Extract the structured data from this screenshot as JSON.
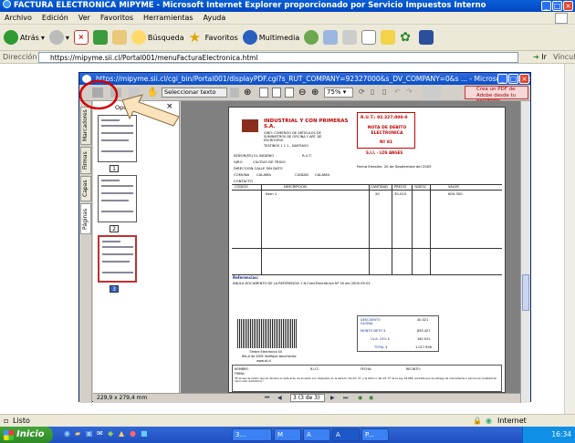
{
  "window": {
    "title": "FACTURA ELECTRONICA MIPYME - Microsoft Internet Explorer proporcionado por Servicio Impuestos Interno"
  },
  "menu": [
    "Archivo",
    "Edición",
    "Ver",
    "Favoritos",
    "Herramientas",
    "Ayuda"
  ],
  "toolbar": {
    "back": "Atrás",
    "search": "Búsqueda",
    "favorites": "Favoritos",
    "multimedia": "Multimedia"
  },
  "address": {
    "label": "Dirección",
    "url": "https://mipyme.sii.cl/Portal001/menuFacturaElectronica.html",
    "go": "Ir",
    "links": "Vínculos"
  },
  "popup": {
    "title": "https://mipyme.sii.cl/cgi_bin/Portal001/displayPDF.cgi?s_RUT_COMPANY=92327000&s_DV_COMPANY=0&s ... - Microsoft Internet Explorer p",
    "select_text": "Seleccionar texto",
    "zoom": "75%",
    "acrobat_ad": "Crea un PDF de Adobe desde tu escritorio",
    "thumbs_label": "Opciones",
    "tabs": [
      "Marcadores",
      "Firmas",
      "Capas",
      "Páginas"
    ],
    "page_nums": [
      "1",
      "2",
      "3"
    ],
    "page_size": "229,9 x 279,4 mm",
    "page_nav": "3 (3 de 3)"
  },
  "doc": {
    "company": "INDUSTRIAL Y CON PRIMERAS S.A.",
    "giro": "GIRO: COMERCIO DE ARTÍCULOS DE SUMINISTROS DE OFICINA Y ART. DE ESCRITORIO",
    "address": "TEATINOS 1 1 1 - SANTIAGO",
    "rut": "R.U.T.: 92.327.000-0",
    "doctype": "NOTA DE DEBITO ELECTRONICA",
    "folio": "Nº 81",
    "sii": "S.I.I. - LOS ANGES",
    "fields": {
      "senor": "SEÑOR(ES) EL INGENIO",
      "rut": "R.U.T.",
      "giro": "GIRO",
      "giro_val": "CULTIVO DE TRIGO",
      "dir": "DIRECCION CALLE SIN DATO",
      "comuna": "COMUNA",
      "comuna_val": "CALAMA",
      "ciudad": "CIUDAD",
      "ciudad_val": "CALAMA",
      "contacto": "CONTACTO",
      "fecha": "Fecha Emisión: 20 de Septiembre del 2005"
    },
    "table_headers": [
      "CÓDIGO",
      "DESCRIPCION",
      "CANTIDAD",
      "PRECIO",
      "%DESC",
      "VALOR"
    ],
    "row": [
      "",
      "Item 1",
      "20",
      "30.015",
      "",
      "600.300"
    ],
    "referencias": "Referencias:",
    "ref_text": "ANULA DOCUMENTO DE LA REFERENCIA 1 N.Cred.Electrónica Nº 30 del 2005-09-02",
    "totals": [
      {
        "label": "DESCUENTO GLOBAL",
        "val": "40.021"
      },
      {
        "label": "MONTO NETO $",
        "val": "855.427"
      },
      {
        "label": "I.V.A. 19% $",
        "val": "162.531"
      },
      {
        "label": "TOTAL $",
        "val": "1.017.958"
      }
    ],
    "timbre": "Timbre Electrónico SII",
    "timbre2": "Res.0 de 2005 Verifique documento:",
    "timbre3": "www.sii.cl",
    "footer_nombre": "NOMBRE:",
    "footer_firma": "FIRMA:",
    "footer_rut": "R.U.T.:",
    "footer_fecha": "FECHA:",
    "footer_recinto": "RECINTO:",
    "footer_legal": "\"El acuse de recibo que se declara en este acto, de acuerdo a lo dispuesto en la letra b) del Art. 4º, y la letra c) del Art. 5º de la Ley 19.983, acredita que la entrega de mercaderías o servicio(s) prestado(s) ha(n) sido recibido(s).\""
  },
  "status": {
    "left": "Listo",
    "zone": "Internet"
  },
  "taskbar": {
    "start": "Inicio",
    "tasks": [
      "3...",
      "M",
      "A",
      "A",
      "P..."
    ],
    "clock": "16:34"
  }
}
